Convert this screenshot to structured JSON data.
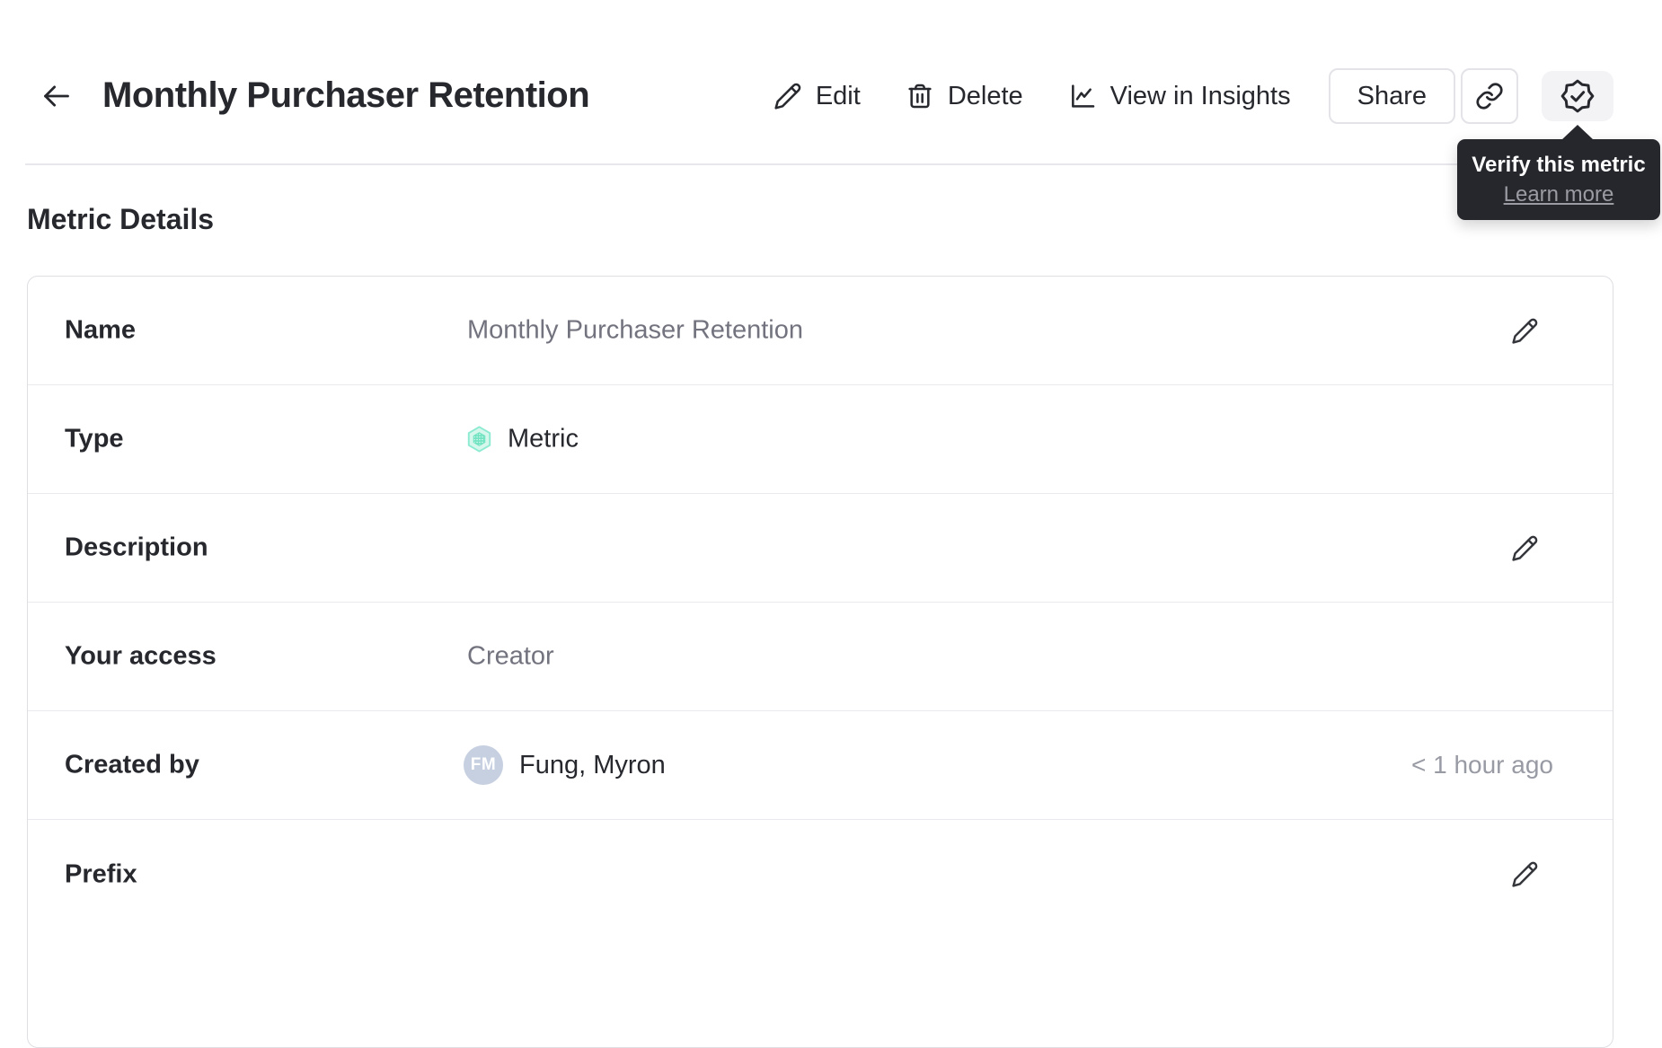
{
  "header": {
    "title": "Monthly Purchaser Retention",
    "edit_label": "Edit",
    "delete_label": "Delete",
    "view_in_insights_label": "View in Insights",
    "share_label": "Share"
  },
  "verify_tooltip": {
    "title": "Verify this metric",
    "link_label": "Learn more"
  },
  "section_title": "Metric Details",
  "details": {
    "rows": [
      {
        "label": "Name",
        "value": "Monthly Purchaser Retention"
      },
      {
        "label": "Type",
        "value": "Metric"
      },
      {
        "label": "Description",
        "value": ""
      },
      {
        "label": "Your access",
        "value": "Creator"
      },
      {
        "label": "Created by",
        "value": "Fung, Myron",
        "avatar_initials": "FM",
        "timestamp": "< 1 hour ago"
      },
      {
        "label": "Prefix",
        "value": ""
      }
    ]
  },
  "colors": {
    "accent_teal": "#6fe3c0",
    "hexagon_light": "#d6f7ec",
    "hexagon_stroke": "#8debd1",
    "tooltip_bg": "#26272d",
    "text_dark": "#26282e",
    "text_gray": "#72737e",
    "text_light_gray": "#989aa4",
    "border": "#e8e8ec",
    "avatar_bg": "#c6d0e0",
    "badge_button_bg": "#f3f3f6"
  }
}
